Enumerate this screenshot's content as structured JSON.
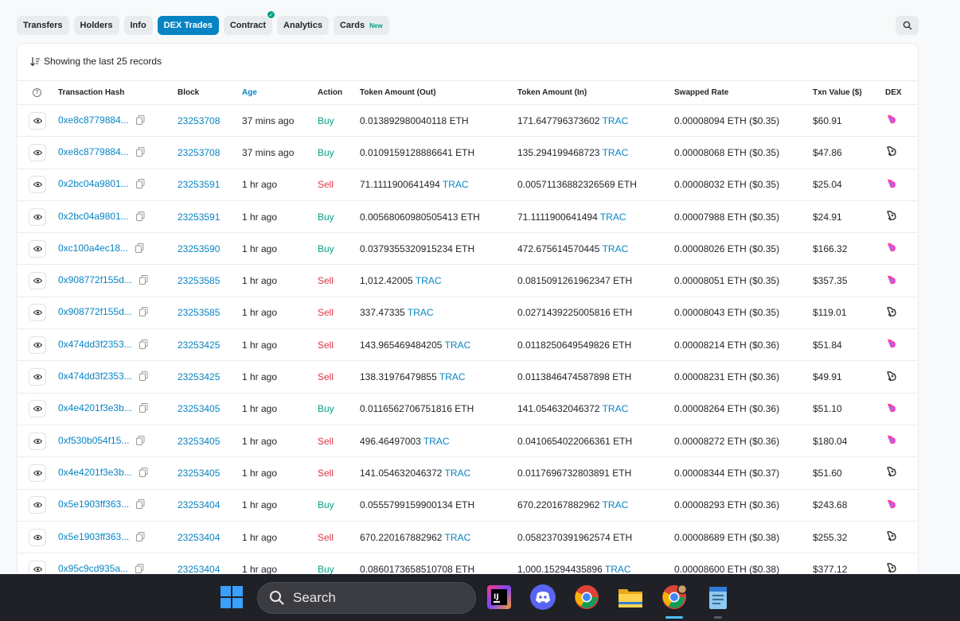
{
  "tabs": [
    {
      "label": "Transfers",
      "active": false
    },
    {
      "label": "Holders",
      "active": false
    },
    {
      "label": "Info",
      "active": false
    },
    {
      "label": "DEX Trades",
      "active": true
    },
    {
      "label": "Contract",
      "active": false,
      "verified": true
    },
    {
      "label": "Analytics",
      "active": false
    },
    {
      "label": "Cards",
      "active": false,
      "badge": "New"
    }
  ],
  "records_label": "Showing the last 25 records",
  "columns": [
    "Transaction Hash",
    "Block",
    "Age",
    "Action",
    "Token Amount (Out)",
    "Token Amount (In)",
    "Swapped Rate",
    "Txn Value ($)",
    "DEX"
  ],
  "rows": [
    {
      "hash": "0xe8c8779884...",
      "block": "23253708",
      "age": "37 mins ago",
      "action": "Buy",
      "out_amount": "0.013892980040118",
      "out_token": "ETH",
      "in_amount": "171.647796373602",
      "in_token": "TRAC",
      "rate": "0.00008094 ETH ($0.35)",
      "value": "$60.91",
      "dex": "uniswap-v3"
    },
    {
      "hash": "0xe8c8779884...",
      "block": "23253708",
      "age": "37 mins ago",
      "action": "Buy",
      "out_amount": "0.0109159128886641",
      "out_token": "ETH",
      "in_amount": "135.294199468723",
      "in_token": "TRAC",
      "rate": "0.00008068 ETH ($0.35)",
      "value": "$47.86",
      "dex": "uniswap-v2"
    },
    {
      "hash": "0x2bc04a9801...",
      "block": "23253591",
      "age": "1 hr ago",
      "action": "Sell",
      "out_amount": "71.1111900641494",
      "out_token": "TRAC",
      "in_amount": "0.00571136882326569",
      "in_token": "ETH",
      "rate": "0.00008032 ETH ($0.35)",
      "value": "$25.04",
      "dex": "uniswap-v3"
    },
    {
      "hash": "0x2bc04a9801...",
      "block": "23253591",
      "age": "1 hr ago",
      "action": "Buy",
      "out_amount": "0.00568060980505413",
      "out_token": "ETH",
      "in_amount": "71.1111900641494",
      "in_token": "TRAC",
      "rate": "0.00007988 ETH ($0.35)",
      "value": "$24.91",
      "dex": "uniswap-v2"
    },
    {
      "hash": "0xc100a4ec18...",
      "block": "23253590",
      "age": "1 hr ago",
      "action": "Buy",
      "out_amount": "0.0379355320915234",
      "out_token": "ETH",
      "in_amount": "472.675614570445",
      "in_token": "TRAC",
      "rate": "0.00008026 ETH ($0.35)",
      "value": "$166.32",
      "dex": "uniswap-v3"
    },
    {
      "hash": "0x908772f155d...",
      "block": "23253585",
      "age": "1 hr ago",
      "action": "Sell",
      "out_amount": "1,012.42005",
      "out_token": "TRAC",
      "in_amount": "0.0815091261962347",
      "in_token": "ETH",
      "rate": "0.00008051 ETH ($0.35)",
      "value": "$357.35",
      "dex": "uniswap-v3"
    },
    {
      "hash": "0x908772f155d...",
      "block": "23253585",
      "age": "1 hr ago",
      "action": "Sell",
      "out_amount": "337.47335",
      "out_token": "TRAC",
      "in_amount": "0.0271439225005816",
      "in_token": "ETH",
      "rate": "0.00008043 ETH ($0.35)",
      "value": "$119.01",
      "dex": "uniswap-v2"
    },
    {
      "hash": "0x474dd3f2353...",
      "block": "23253425",
      "age": "1 hr ago",
      "action": "Sell",
      "out_amount": "143.965469484205",
      "out_token": "TRAC",
      "in_amount": "0.0118250649549826",
      "in_token": "ETH",
      "rate": "0.00008214 ETH ($0.36)",
      "value": "$51.84",
      "dex": "uniswap-v3"
    },
    {
      "hash": "0x474dd3f2353...",
      "block": "23253425",
      "age": "1 hr ago",
      "action": "Sell",
      "out_amount": "138.31976479855",
      "out_token": "TRAC",
      "in_amount": "0.0113846474587898",
      "in_token": "ETH",
      "rate": "0.00008231 ETH ($0.36)",
      "value": "$49.91",
      "dex": "uniswap-v2"
    },
    {
      "hash": "0x4e4201f3e3b...",
      "block": "23253405",
      "age": "1 hr ago",
      "action": "Buy",
      "out_amount": "0.0116562706751816",
      "out_token": "ETH",
      "in_amount": "141.054632046372",
      "in_token": "TRAC",
      "rate": "0.00008264 ETH ($0.36)",
      "value": "$51.10",
      "dex": "uniswap-v3"
    },
    {
      "hash": "0xf530b054f15...",
      "block": "23253405",
      "age": "1 hr ago",
      "action": "Sell",
      "out_amount": "496.46497003",
      "out_token": "TRAC",
      "in_amount": "0.0410654022066361",
      "in_token": "ETH",
      "rate": "0.00008272 ETH ($0.36)",
      "value": "$180.04",
      "dex": "uniswap-v3"
    },
    {
      "hash": "0x4e4201f3e3b...",
      "block": "23253405",
      "age": "1 hr ago",
      "action": "Sell",
      "out_amount": "141.054632046372",
      "out_token": "TRAC",
      "in_amount": "0.0117696732803891",
      "in_token": "ETH",
      "rate": "0.00008344 ETH ($0.37)",
      "value": "$51.60",
      "dex": "uniswap-v2"
    },
    {
      "hash": "0x5e1903ff363...",
      "block": "23253404",
      "age": "1 hr ago",
      "action": "Buy",
      "out_amount": "0.0555799159900134",
      "out_token": "ETH",
      "in_amount": "670.220167882962",
      "in_token": "TRAC",
      "rate": "0.00008293 ETH ($0.36)",
      "value": "$243.68",
      "dex": "uniswap-v3"
    },
    {
      "hash": "0x5e1903ff363...",
      "block": "23253404",
      "age": "1 hr ago",
      "action": "Sell",
      "out_amount": "670.220167882962",
      "out_token": "TRAC",
      "in_amount": "0.0582370391962574",
      "in_token": "ETH",
      "rate": "0.00008689 ETH ($0.38)",
      "value": "$255.32",
      "dex": "uniswap-v2"
    },
    {
      "hash": "0x95c9cd935a...",
      "block": "23253404",
      "age": "1 hr ago",
      "action": "Buy",
      "out_amount": "0.0860173658510708",
      "out_token": "ETH",
      "in_amount": "1,000.15294435896",
      "in_token": "TRAC",
      "rate": "0.00008600 ETH ($0.38)",
      "value": "$377.12",
      "dex": "uniswap-v2"
    }
  ],
  "taskbar": {
    "search_label": "Search",
    "apps": [
      "intellij-icon",
      "discord-icon",
      "chrome-icon",
      "file-explorer-icon",
      "chrome-profile-icon",
      "notepad-icon"
    ]
  },
  "colors": {
    "primary": "#0784c3",
    "buy": "#00a186",
    "sell": "#dc3545"
  }
}
